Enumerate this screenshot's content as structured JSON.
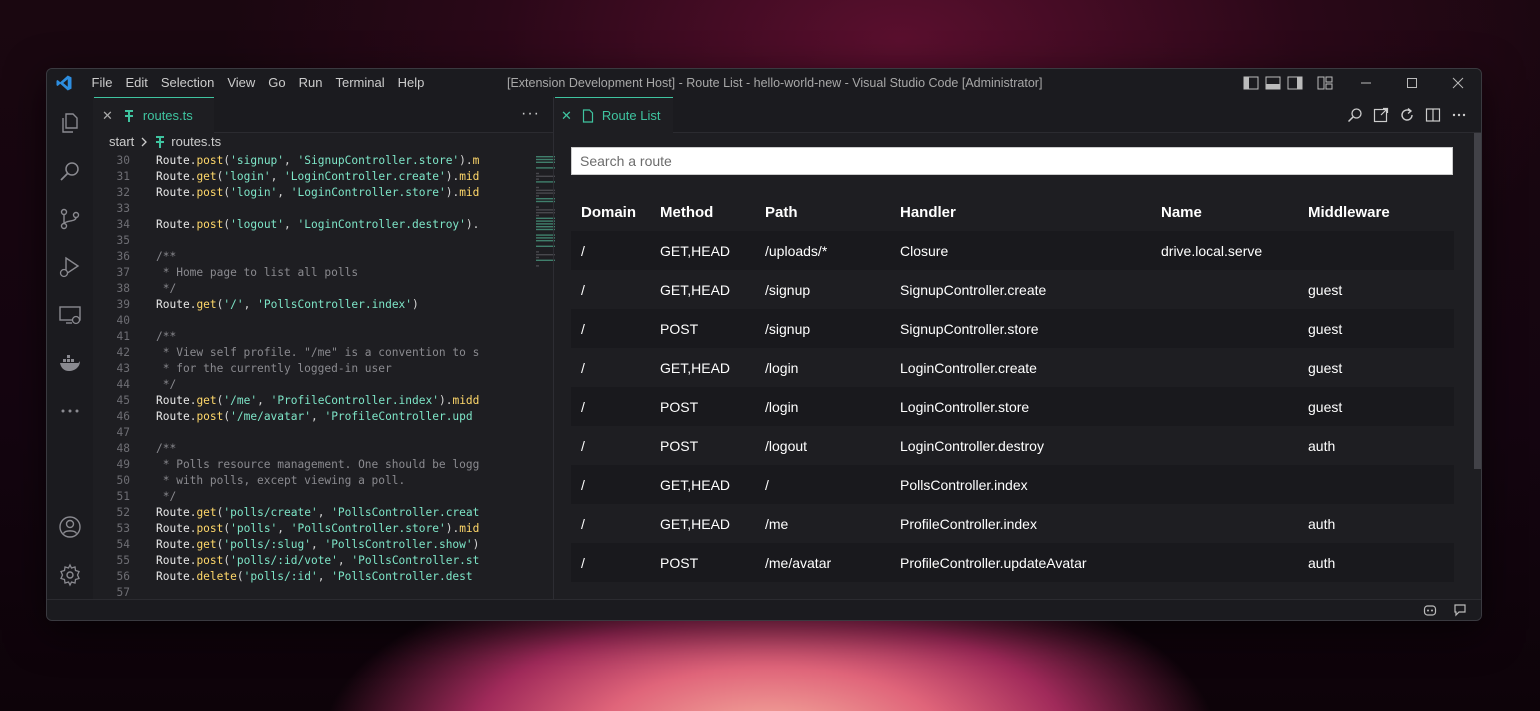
{
  "titlebar": {
    "menu": [
      "File",
      "Edit",
      "Selection",
      "View",
      "Go",
      "Run",
      "Terminal",
      "Help"
    ],
    "title": "[Extension Development Host] - Route List - hello-world-new - Visual Studio Code [Administrator]"
  },
  "editor": {
    "tab_label": "routes.ts",
    "breadcrumb": {
      "folder": "start",
      "file": "routes.ts"
    },
    "lines": [
      {
        "n": "30",
        "code": "Route.post('signup', 'SignupController.store').m"
      },
      {
        "n": "31",
        "code": "Route.get('login', 'LoginController.create').mid"
      },
      {
        "n": "32",
        "code": "Route.post('login', 'LoginController.store').mid"
      },
      {
        "n": "33",
        "code": ""
      },
      {
        "n": "34",
        "code": "Route.post('logout', 'LoginController.destroy')."
      },
      {
        "n": "35",
        "code": ""
      },
      {
        "n": "36",
        "code": "/**"
      },
      {
        "n": "37",
        "code": " * Home page to list all polls"
      },
      {
        "n": "38",
        "code": " */"
      },
      {
        "n": "39",
        "code": "Route.get('/', 'PollsController.index')"
      },
      {
        "n": "40",
        "code": ""
      },
      {
        "n": "41",
        "code": "/**"
      },
      {
        "n": "42",
        "code": " * View self profile. \"/me\" is a convention to s"
      },
      {
        "n": "43",
        "code": " * for the currently logged-in user"
      },
      {
        "n": "44",
        "code": " */"
      },
      {
        "n": "45",
        "code": "Route.get('/me', 'ProfileController.index').midd"
      },
      {
        "n": "46",
        "code": "Route.post('/me/avatar', 'ProfileController.upd"
      },
      {
        "n": "47",
        "code": ""
      },
      {
        "n": "48",
        "code": "/**"
      },
      {
        "n": "49",
        "code": " * Polls resource management. One should be logg"
      },
      {
        "n": "50",
        "code": " * with polls, except viewing a poll."
      },
      {
        "n": "51",
        "code": " */"
      },
      {
        "n": "52",
        "code": "Route.get('polls/create', 'PollsController.creat"
      },
      {
        "n": "53",
        "code": "Route.post('polls', 'PollsController.store').mid"
      },
      {
        "n": "54",
        "code": "Route.get('polls/:slug', 'PollsController.show')"
      },
      {
        "n": "55",
        "code": "Route.post('polls/:id/vote', 'PollsController.st"
      },
      {
        "n": "56",
        "code": "Route.delete('polls/:id', 'PollsController.dest"
      },
      {
        "n": "57",
        "code": ""
      }
    ]
  },
  "route_list": {
    "tab_label": "Route List",
    "search_placeholder": "Search a route",
    "columns": [
      "Domain",
      "Method",
      "Path",
      "Handler",
      "Name",
      "Middleware"
    ],
    "rows": [
      [
        "/",
        "GET,HEAD",
        "/uploads/*",
        "Closure",
        "drive.local.serve",
        ""
      ],
      [
        "/",
        "GET,HEAD",
        "/signup",
        "SignupController.create",
        "",
        "guest"
      ],
      [
        "/",
        "POST",
        "/signup",
        "SignupController.store",
        "",
        "guest"
      ],
      [
        "/",
        "GET,HEAD",
        "/login",
        "LoginController.create",
        "",
        "guest"
      ],
      [
        "/",
        "POST",
        "/login",
        "LoginController.store",
        "",
        "guest"
      ],
      [
        "/",
        "POST",
        "/logout",
        "LoginController.destroy",
        "",
        "auth"
      ],
      [
        "/",
        "GET,HEAD",
        "/",
        "PollsController.index",
        "",
        ""
      ],
      [
        "/",
        "GET,HEAD",
        "/me",
        "ProfileController.index",
        "",
        "auth"
      ],
      [
        "/",
        "POST",
        "/me/avatar",
        "ProfileController.updateAvatar",
        "",
        "auth"
      ]
    ]
  },
  "colors": {
    "accent": "#3fc4a0",
    "code_function": "#ffd86a",
    "code_string": "#7ee6c8",
    "vscode_blue": "#2d8ee0"
  }
}
